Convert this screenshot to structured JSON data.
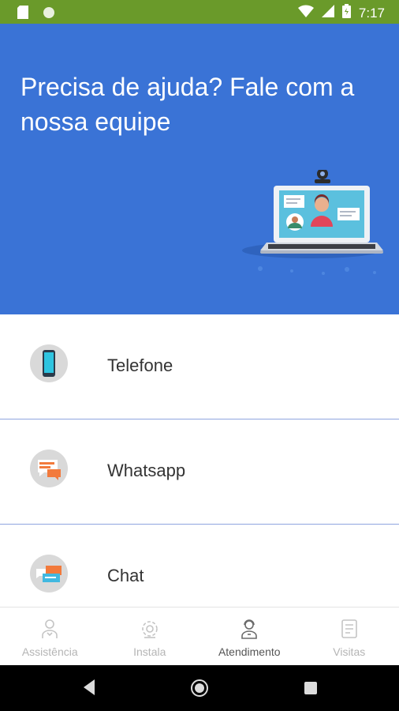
{
  "status_bar": {
    "time": "7:17",
    "color": "#6a9a2a"
  },
  "hero": {
    "title": "Precisa de ajuda? Fale com a nossa equipe",
    "background": "#3a73d6"
  },
  "options": [
    {
      "label": "Telefone",
      "icon": "smartphone-icon"
    },
    {
      "label": "Whatsapp",
      "icon": "chat-bubble-icon"
    },
    {
      "label": "Chat",
      "icon": "chat-bubbles-icon"
    }
  ],
  "bottom_nav": {
    "items": [
      {
        "label": "Assistência",
        "icon": "technician-icon",
        "active": false
      },
      {
        "label": "Instala",
        "icon": "gear-icon",
        "active": false
      },
      {
        "label": "Atendimento",
        "icon": "attendant-icon",
        "active": true
      },
      {
        "label": "Visitas",
        "icon": "checklist-icon",
        "active": false
      }
    ]
  }
}
